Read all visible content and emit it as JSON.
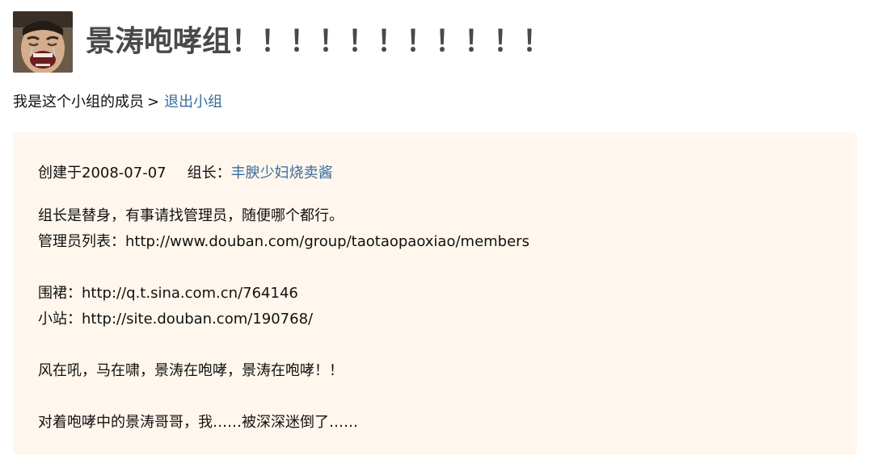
{
  "header": {
    "avatar_icon": "crying-face-avatar",
    "title": "景涛咆哮组！！！！！！！！！！！"
  },
  "membership": {
    "status_text": "我是这个小组的成员",
    "arrow": ">",
    "leave_link": "退出小组"
  },
  "info": {
    "created": "创建于2008-07-07",
    "owner_label": "组长：",
    "owner_name": "丰腴少妇烧卖酱",
    "lines": [
      "组长是替身，有事请找管理员，随便哪个都行。",
      "管理员列表：http://www.douban.com/group/taotaopaoxiao/members",
      "",
      "围裙：http://q.t.sina.com.cn/764146",
      "小站：http://site.douban.com/190768/",
      "",
      "风在吼，马在啸，景涛在咆哮，景涛在咆哮！！",
      "",
      "对着咆哮中的景涛哥哥，我……被深深迷倒了……"
    ]
  },
  "colors": {
    "link": "#3a6b9a",
    "info_background": "#fff6ed",
    "title": "#494949"
  }
}
